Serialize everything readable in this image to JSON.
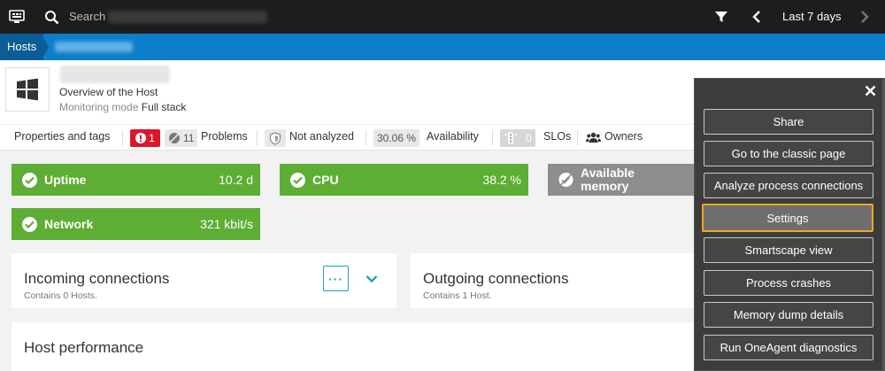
{
  "topbar": {
    "search_placeholder": "Search",
    "time_range": "Last 7 days"
  },
  "breadcrumb": {
    "root": "Hosts"
  },
  "host": {
    "subtitle": "Overview of the Host",
    "mode_label": "Monitoring mode",
    "mode_value": "Full stack"
  },
  "tags_bar": {
    "properties": "Properties and tags",
    "problems_open": "1",
    "problems_closed": "11",
    "problems_label": "Problems",
    "not_analyzed": "Not analyzed",
    "availability_value": "30.06 %",
    "availability_label": "Availability",
    "slo_count": "0",
    "slo_label": "SLOs",
    "owners": "Owners"
  },
  "metrics": {
    "uptime": {
      "label": "Uptime",
      "value": "10.2 d"
    },
    "cpu": {
      "label": "CPU",
      "value": "38.2 %"
    },
    "memory": {
      "label_line1": "Available",
      "label_line2": "memory"
    },
    "network": {
      "label": "Network",
      "value": "321 kbit/s"
    }
  },
  "incoming": {
    "title": "Incoming connections",
    "sub": "Contains 0 Hosts."
  },
  "outgoing": {
    "title": "Outgoing connections",
    "sub": "Contains 1 Host."
  },
  "performance": {
    "title": "Host performance"
  },
  "menu": {
    "items": [
      "Share",
      "Go to the classic page",
      "Analyze process connections",
      "Settings",
      "Smartscape view",
      "Process crashes",
      "Memory dump details",
      "Run OneAgent diagnostics"
    ],
    "active_index": 3
  },
  "colors": {
    "green": "#5ead35",
    "accent": "#0d7ec9",
    "problem_red": "#dc172a",
    "highlight": "#f5a623"
  }
}
